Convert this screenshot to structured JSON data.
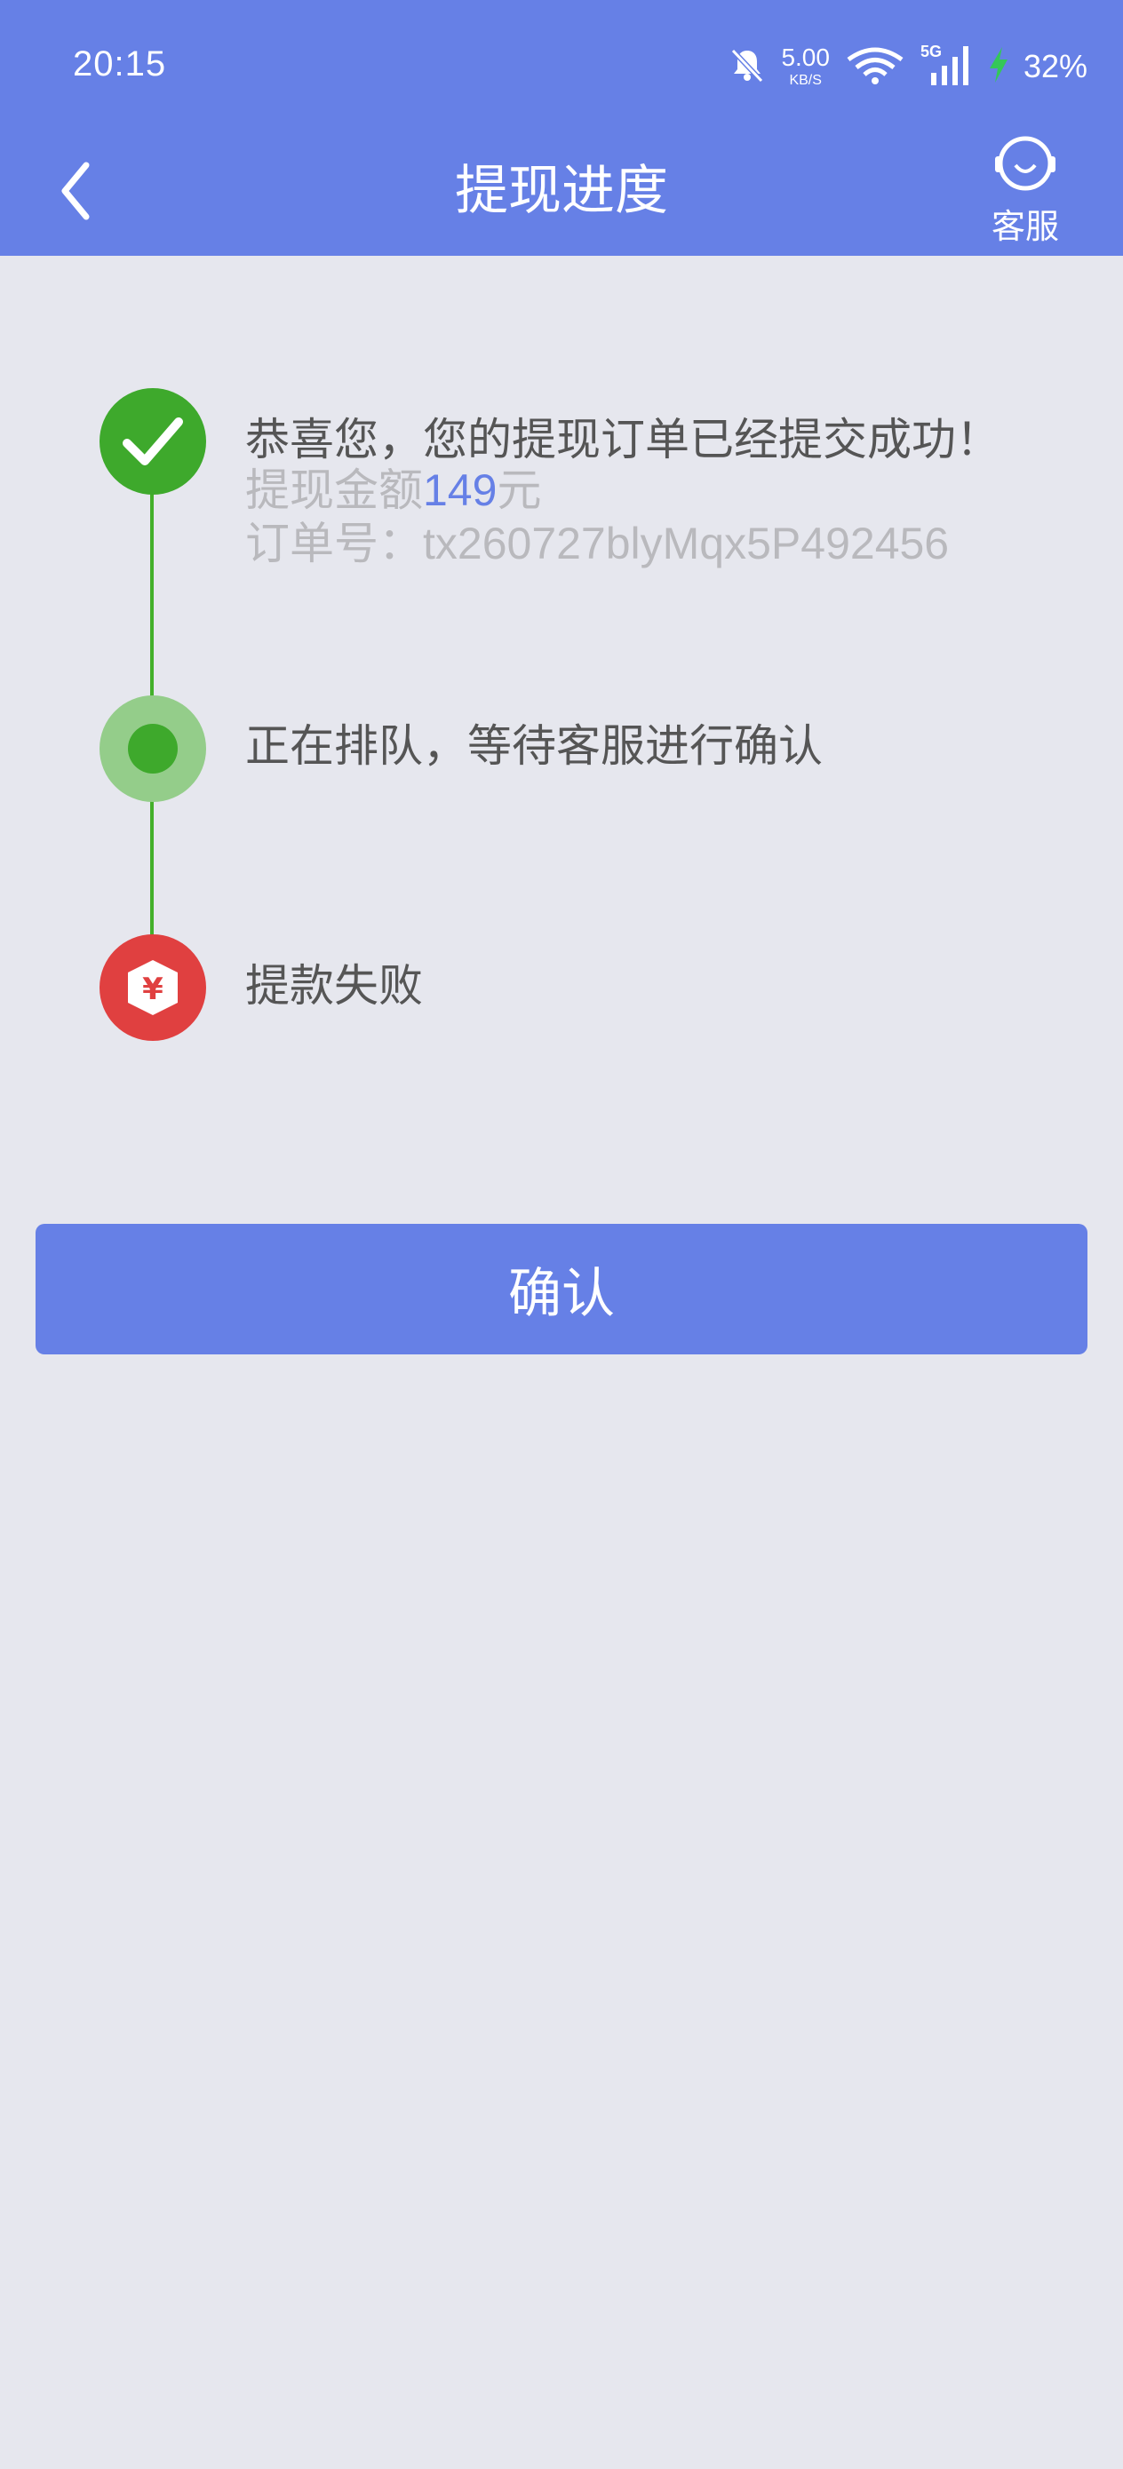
{
  "status_bar": {
    "time": "20:15",
    "net_speed_value": "5.00",
    "net_speed_unit": "KB/S",
    "network_type": "5G",
    "battery_percent": "32%"
  },
  "header": {
    "title": "提现进度",
    "service_label": "客服"
  },
  "progress": {
    "step1": {
      "title": "恭喜您，您的提现订单已经提交成功！",
      "amount_prefix": "提现金额",
      "amount_value": "149",
      "amount_suffix": "元",
      "order_label": "订单号：",
      "order_number": "tx260727blyMqx5P492456"
    },
    "step2": {
      "title": "正在排队，等待客服进行确认"
    },
    "step3": {
      "title": "提款失败"
    }
  },
  "confirm_button": {
    "label": "确认"
  },
  "colors": {
    "accent": "#6680e6",
    "success": "#3ea92c",
    "pending": "#94cd8a",
    "failure": "#e04040",
    "background": "#e6e7ee"
  }
}
